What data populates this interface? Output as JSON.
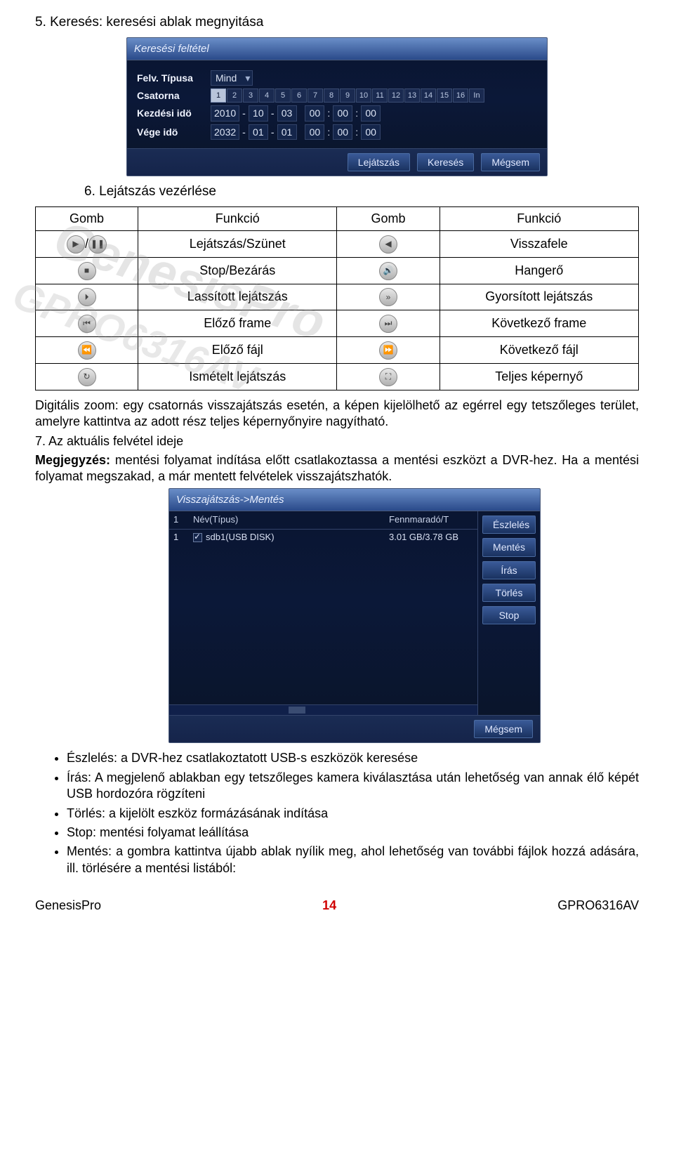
{
  "section5_title": "5. Keresés: keresési ablak megnyitása",
  "dvr1": {
    "title": "Keresési feltétel",
    "row_type_label": "Felv. Típusa",
    "row_type_value": "Mind",
    "row_channel_label": "Csatorna",
    "channels": [
      "1",
      "2",
      "3",
      "4",
      "5",
      "6",
      "7",
      "8",
      "9",
      "10",
      "11",
      "12",
      "13",
      "14",
      "15",
      "16",
      "In"
    ],
    "row_start_label": "Kezdési idö",
    "start_date": [
      "2010",
      "10",
      "03",
      "00",
      "00",
      "00"
    ],
    "row_end_label": "Vége idö",
    "end_date": [
      "2032",
      "01",
      "01",
      "00",
      "00",
      "00"
    ],
    "btn_play": "Lejátszás",
    "btn_search": "Keresés",
    "btn_cancel": "Mégsem"
  },
  "section6_title": "6. Lejátszás vezérlése",
  "fntable": {
    "h1": "Gomb",
    "h2": "Funkció",
    "h3": "Gomb",
    "h4": "Funkció",
    "r1c2": "Lejátszás/Szünet",
    "r1c4": "Visszafele",
    "r2c2": "Stop/Bezárás",
    "r2c4": "Hangerő",
    "r3c2": "Lassított lejátszás",
    "r3c4": "Gyorsított lejátszás",
    "r4c2": "Előző frame",
    "r4c4": "Következő frame",
    "r5c2": "Előző fájl",
    "r5c4": "Következő fájl",
    "r6c2": "Ismételt lejátszás",
    "r6c4": "Teljes képernyő"
  },
  "zoom_text": "Digitális zoom: egy csatornás visszajátszás esetén, a képen kijelölhető az egérrel egy tetszőleges terület, amelyre kattintva az adott rész teljes képernyőnyire nagyítható.",
  "item7": "7. Az aktuális felvétel ideje",
  "note_label": "Megjegyzés:",
  "note_text": "mentési folyamat indítása előtt csatlakoztassa a mentési eszközt a DVR-hez. Ha a mentési folyamat megszakad, a már mentett felvételek visszajátszhatók.",
  "dvr2": {
    "title": "Visszajátszás->Mentés",
    "col_idx": "1",
    "col_name": "Név(Típus)",
    "col_rem": "Fennmaradó/T",
    "row_idx": "1",
    "row_name": "sdb1(USB DISK)",
    "row_rem": "3.01 GB/3.78 GB",
    "btn_detect": "Észlelés",
    "btn_save": "Mentés",
    "btn_write": "Írás",
    "btn_delete": "Törlés",
    "btn_stop": "Stop",
    "btn_cancel": "Mégsem"
  },
  "bullets": {
    "b1": "Észlelés: a DVR-hez csatlakoztatott USB-s eszközök keresése",
    "b2": "Írás: A megjelenő ablakban egy tetszőleges kamera kiválasztása után lehetőség van annak élő képét USB hordozóra rögzíteni",
    "b3": "Törlés: a kijelölt eszköz formázásának indítása",
    "b4": "Stop: mentési folyamat leállítása",
    "b5": "Mentés: a gombra kattintva újabb ablak nyílik meg, ahol lehetőség van további fájlok hozzá adására, ill. törlésére a mentési listából:"
  },
  "footer": {
    "left": "GenesisPro",
    "page": "14",
    "right": "GPRO6316AV"
  },
  "watermark1": "GenesisPro",
  "watermark2": "GPRO6316AV"
}
